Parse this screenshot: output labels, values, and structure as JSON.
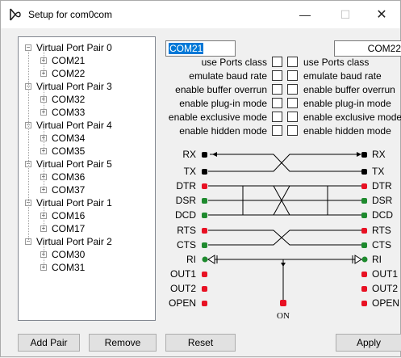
{
  "window": {
    "title": "Setup for com0com",
    "minimize": "—",
    "maximize": "☐",
    "close": "✕",
    "icon": "com0com-icon"
  },
  "tree": {
    "pairs": [
      {
        "label": "Virtual Port Pair 0",
        "ports": [
          "COM21",
          "COM22"
        ]
      },
      {
        "label": "Virtual Port Pair 3",
        "ports": [
          "COM32",
          "COM33"
        ]
      },
      {
        "label": "Virtual Port Pair 4",
        "ports": [
          "COM34",
          "COM35"
        ]
      },
      {
        "label": "Virtual Port Pair 5",
        "ports": [
          "COM36",
          "COM37"
        ]
      },
      {
        "label": "Virtual Port Pair 1",
        "ports": [
          "COM16",
          "COM17"
        ]
      },
      {
        "label": "Virtual Port Pair 2",
        "ports": [
          "COM30",
          "COM31"
        ]
      }
    ],
    "expand_glyph": "+",
    "collapse_glyph": "−"
  },
  "ports": {
    "left_name": "COM21",
    "right_name": "COM22"
  },
  "options": {
    "left": [
      "use Ports class",
      "emulate baud rate",
      "enable buffer overrun",
      "enable plug-in mode",
      "enable exclusive mode",
      "enable hidden mode"
    ],
    "right": [
      "use Ports class",
      "emulate baud rate",
      "enable buffer overrun",
      "enable plug-in mode",
      "enable exclusive mode",
      "enable hidden mode"
    ]
  },
  "signals": {
    "left": [
      "RX",
      "TX",
      "DTR",
      "DSR",
      "DCD",
      "RTS",
      "CTS",
      "RI",
      "OUT1",
      "OUT2",
      "OPEN"
    ],
    "right": [
      "RX",
      "TX",
      "DTR",
      "DSR",
      "DCD",
      "RTS",
      "CTS",
      "RI",
      "OUT1",
      "OUT2",
      "OPEN"
    ],
    "on_label": "ON",
    "colors": {
      "black": "#000000",
      "red": "#e81123",
      "green": "#1e8a2e"
    }
  },
  "buttons": {
    "add_pair": "Add Pair",
    "remove": "Remove",
    "reset": "Reset",
    "apply": "Apply"
  }
}
